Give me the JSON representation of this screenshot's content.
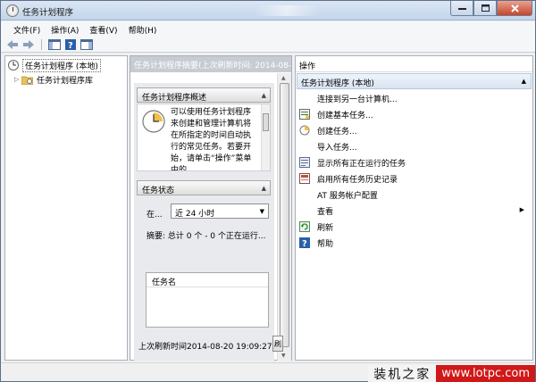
{
  "window": {
    "title": "任务计划程序"
  },
  "menu": [
    "文件(F)",
    "操作(A)",
    "查看(V)",
    "帮助(H)"
  ],
  "tree": {
    "root": "任务计划程序 (本地)",
    "child": "任务计划程序库"
  },
  "middle": {
    "header": "任务计划程序摘要(上次刷新时间: 2014-08-20",
    "overview_title": "任务计划程序概述",
    "overview_text": "可以使用任务计划程序来创建和管理计算机将在所指定的时间自动执行的常见任务。若要开始，请单击“操作”菜单中的",
    "status_title": "任务状态",
    "filter_label": "在...",
    "filter_value": "近 24 小时",
    "summary": "摘要: 总计 0 个 - 0 个正在运行...",
    "column_task_name": "任务名",
    "last_refresh": "上次刷新时间2014-08-20 19:09:27",
    "refresh_button": "刷"
  },
  "actions": {
    "title": "操作",
    "group": "任务计划程序 (本地)",
    "items": [
      {
        "label": "连接到另一台计算机...",
        "icon": "none"
      },
      {
        "label": "创建基本任务...",
        "icon": "create-basic-task-icon"
      },
      {
        "label": "创建任务...",
        "icon": "create-task-icon"
      },
      {
        "label": "导入任务...",
        "icon": "none"
      },
      {
        "label": "显示所有正在运行的任务",
        "icon": "running-tasks-icon"
      },
      {
        "label": "启用所有任务历史记录",
        "icon": "task-history-icon"
      },
      {
        "label": "AT 服务帐户配置",
        "icon": "none"
      },
      {
        "label": "查看",
        "icon": "none"
      },
      {
        "label": "刷新",
        "icon": "refresh-icon"
      },
      {
        "label": "帮助",
        "icon": "help-icon"
      }
    ]
  },
  "watermark": {
    "chinese": "装机之家",
    "url": "www.lotpc.com"
  },
  "colors": {
    "accent": "#2a5fa8",
    "header_gray": "#c7cbd2",
    "watermark_red": "#d01818"
  }
}
